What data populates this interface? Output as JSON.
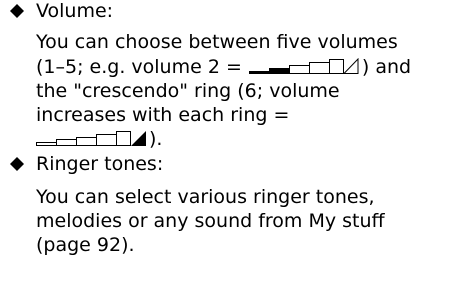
{
  "colors": {
    "text": "#000000",
    "background": "#ffffff"
  },
  "sections": [
    {
      "bullet_icon": "diamond-bullet-icon",
      "title": "Volume:",
      "lines": {
        "l1": "You can choose between five volumes",
        "l2a": "(1–5; e.g. volume 2 = ",
        "l2b": ") and",
        "l3": "the \"crescendo\" ring (6; volume",
        "l4": "increases with each ring =",
        "l5b": ")."
      },
      "volume_icon_example": {
        "icon": "volume-level-icon",
        "level": 2,
        "of": 5
      },
      "crescendo_icon": {
        "icon": "volume-crescendo-icon",
        "level": 6
      }
    },
    {
      "bullet_icon": "diamond-bullet-icon",
      "title": "Ringer tones:",
      "lines": {
        "l1": "You can select various ringer tones,",
        "l2": "melodies or any sound from My stuff",
        "l3": "(page 92)."
      }
    }
  ]
}
